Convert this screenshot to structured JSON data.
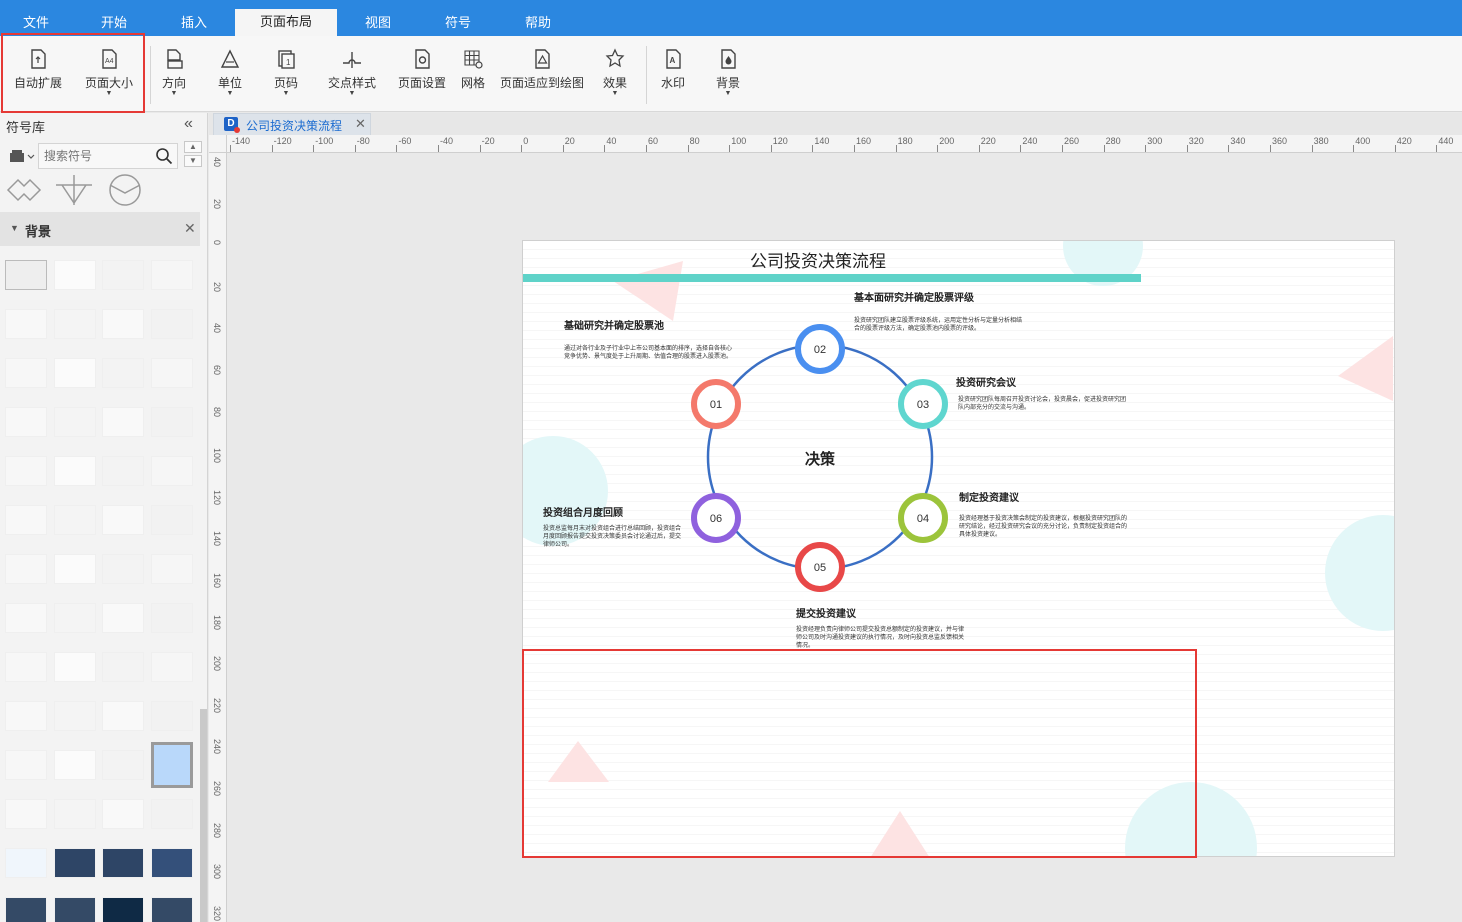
{
  "menubar": {
    "tabs": [
      {
        "label": "文件"
      },
      {
        "label": "开始"
      },
      {
        "label": "插入"
      },
      {
        "label": "页面布局"
      },
      {
        "label": "视图"
      },
      {
        "label": "符号"
      },
      {
        "label": "帮助"
      }
    ],
    "active_tab": "页面布局",
    "accent_color": "#2b87e0"
  },
  "ribbon": {
    "buttons": [
      {
        "label": "自动扩展",
        "icon": "auto-expand-icon"
      },
      {
        "label": "页面大小",
        "icon": "page-size-icon"
      },
      {
        "label": "方向",
        "icon": "orientation-icon"
      },
      {
        "label": "单位",
        "icon": "unit-icon"
      },
      {
        "label": "页码",
        "icon": "page-number-icon"
      },
      {
        "label": "交点样式",
        "icon": "crossover-style-icon"
      },
      {
        "label": "页面设置",
        "icon": "page-setup-icon"
      },
      {
        "label": "网格",
        "icon": "grid-icon"
      },
      {
        "label": "页面适应到绘图",
        "icon": "fit-page-icon"
      },
      {
        "label": "效果",
        "icon": "effects-icon"
      },
      {
        "label": "水印",
        "icon": "watermark-icon"
      },
      {
        "label": "背景",
        "icon": "background-icon"
      }
    ],
    "highlight_color": "#e53935"
  },
  "library": {
    "title": "符号库",
    "search_placeholder": "搜索符号",
    "section": "背景"
  },
  "document": {
    "tab_label": "公司投资决策流程"
  },
  "rulers": {
    "horizontal": [
      "-140",
      "-120",
      "-100",
      "-80",
      "-60",
      "-40",
      "-20",
      "0",
      "20",
      "40",
      "60",
      "80",
      "100",
      "120",
      "140",
      "160",
      "180",
      "200",
      "220",
      "240",
      "260",
      "280",
      "300",
      "320",
      "340",
      "360",
      "380",
      "400",
      "420",
      "440"
    ],
    "vertical": [
      "40",
      "20",
      "0",
      "20",
      "40",
      "60",
      "80",
      "100",
      "120",
      "140",
      "160",
      "180",
      "200",
      "220",
      "240",
      "260",
      "280",
      "300",
      "320"
    ]
  },
  "diagram": {
    "title": "公司投资决策流程",
    "center": "决策",
    "ring_color": "#3a6fc4",
    "bar_color": "#5fd3c9",
    "nodes": [
      {
        "num": "01",
        "color": "#f4796b",
        "heading": "基础研究并确定股票池",
        "body": "通过对各行业及子行业中上市公司基本面的排序，选择自各核心竞争优势、景气度处于上升周期、估值合理的股票进入股票池。"
      },
      {
        "num": "02",
        "color": "#4a8ff0",
        "heading": "基本面研究并确定股票评级",
        "body": "投资研究团队建立股票评级系统，运用定性分析与定量分析相结合的股票评级方法，确定股票池内股票的评级。"
      },
      {
        "num": "03",
        "color": "#5fd6cf",
        "heading": "投资研究会议",
        "body": "投资研究团队每周召开投资讨论会，投资晨会，促进投资研究团队内部充分的交流与沟通。"
      },
      {
        "num": "04",
        "color": "#9cc43b",
        "heading": "制定投资建议",
        "body": "投资经理基于投资决策会制定的投资建议，根据投资研究团队的研究结论，经过投资研究会议的充分讨论，负责制定投资组合的具体投资建议。"
      },
      {
        "num": "05",
        "color": "#e84848",
        "heading": "提交投资建议",
        "body": "投资经理负责向律师公司提交投资总额制定的投资建议，并与律师公司及时沟通投资建议的执行情况，及时向投资总监反馈相关情况。"
      },
      {
        "num": "06",
        "color": "#8f61de",
        "heading": "投资组合月度回顾",
        "body": "投资总监每月末对投资组合进行总结回顾，投资组合月度回顾报告提交投资决策委员会讨论通过后，提交律师公司。"
      }
    ]
  }
}
